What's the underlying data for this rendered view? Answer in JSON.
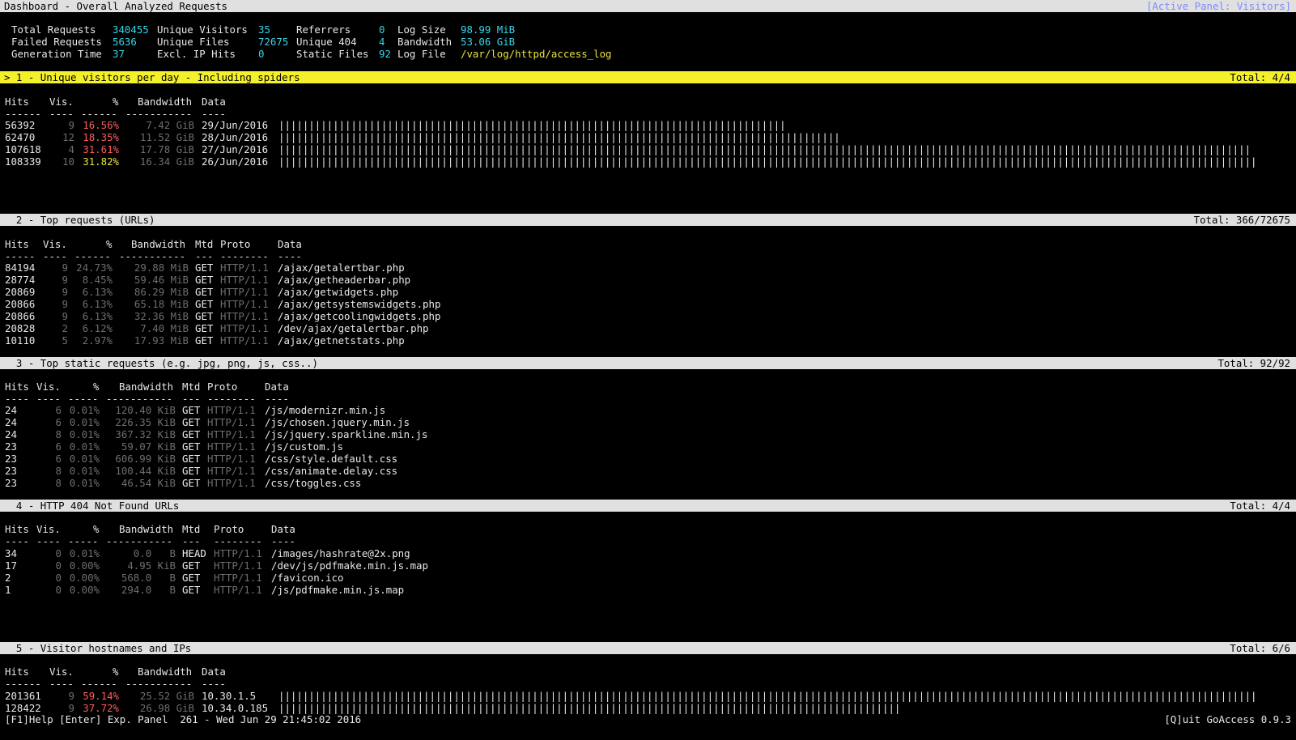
{
  "title": "Dashboard - Overall Analyzed Requests",
  "active_panel": "[Active Panel: Visitors]",
  "overall": {
    "total_requests_label": "Total Requests",
    "total_requests": "340455",
    "failed_requests_label": "Failed Requests",
    "failed_requests": "5636",
    "generation_time_label": "Generation Time",
    "generation_time": "37",
    "unique_visitors_label": "Unique Visitors",
    "unique_visitors": "35",
    "unique_files_label": "Unique Files",
    "unique_files": "72675",
    "excl_ip_hits_label": "Excl. IP Hits",
    "excl_ip_hits": "0",
    "referrers_label": "Referrers",
    "referrers": "0",
    "unique_404_label": "Unique 404",
    "unique_404": "4",
    "static_files_label": "Static Files",
    "static_files": "92",
    "log_size_label": "Log Size",
    "log_size": "98.99 MiB",
    "bandwidth_label": "Bandwidth",
    "bandwidth": "53.06 GiB",
    "log_file_label": "Log File",
    "log_file": "/var/log/httpd/access_log"
  },
  "panels": {
    "visitors": {
      "title": "> 1 - Unique visitors per day - Including spiders",
      "total": "Total: 4/4",
      "headers": {
        "hits": "Hits",
        "vis": "Vis.",
        "pct": "%",
        "bw": "Bandwidth",
        "data": "Data"
      },
      "dashes": {
        "hits": "------",
        "vis": "----",
        "pct": "------",
        "bw": "-----------",
        "data": "----"
      },
      "rows": [
        {
          "hits": "56392",
          "vis": "9",
          "pct": "16.56%",
          "bw": "7.42 GiB",
          "data": "29/Jun/2016",
          "bar": 0.521
        },
        {
          "hits": "62470",
          "vis": "12",
          "pct": "18.35%",
          "bw": "11.52 GiB",
          "data": "28/Jun/2016",
          "bar": 0.577
        },
        {
          "hits": "107618",
          "vis": "4",
          "pct": "31.61%",
          "bw": "17.78 GiB",
          "data": "27/Jun/2016",
          "bar": 0.994
        },
        {
          "hits": "108339",
          "vis": "10",
          "pct": "31.82%",
          "bw": "16.34 GiB",
          "data": "26/Jun/2016",
          "bar": 1.0
        }
      ]
    },
    "requests": {
      "title": "  2 - Top requests (URLs)",
      "total": "Total: 366/72675",
      "headers": {
        "hits": "Hits",
        "vis": "Vis.",
        "pct": "%",
        "bw": "Bandwidth",
        "mtd": "Mtd",
        "proto": "Proto",
        "data": "Data"
      },
      "dashes": {
        "hits": "-----",
        "vis": "----",
        "pct": "------",
        "bw": "-----------",
        "mtd": "---",
        "proto": "--------",
        "data": "----"
      },
      "rows": [
        {
          "hits": "84194",
          "vis": "9",
          "pct": "24.73%",
          "bw": "29.88 MiB",
          "mtd": "GET",
          "proto": "HTTP/1.1",
          "data": "/ajax/getalertbar.php"
        },
        {
          "hits": "28774",
          "vis": "9",
          "pct": "8.45%",
          "bw": "59.46 MiB",
          "mtd": "GET",
          "proto": "HTTP/1.1",
          "data": "/ajax/getheaderbar.php"
        },
        {
          "hits": "20869",
          "vis": "9",
          "pct": "6.13%",
          "bw": "86.29 MiB",
          "mtd": "GET",
          "proto": "HTTP/1.1",
          "data": "/ajax/getwidgets.php"
        },
        {
          "hits": "20866",
          "vis": "9",
          "pct": "6.13%",
          "bw": "65.18 MiB",
          "mtd": "GET",
          "proto": "HTTP/1.1",
          "data": "/ajax/getsystemswidgets.php"
        },
        {
          "hits": "20866",
          "vis": "9",
          "pct": "6.13%",
          "bw": "32.36 MiB",
          "mtd": "GET",
          "proto": "HTTP/1.1",
          "data": "/ajax/getcoolingwidgets.php"
        },
        {
          "hits": "20828",
          "vis": "2",
          "pct": "6.12%",
          "bw": "7.40 MiB",
          "mtd": "GET",
          "proto": "HTTP/1.1",
          "data": "/dev/ajax/getalertbar.php"
        },
        {
          "hits": "10110",
          "vis": "5",
          "pct": "2.97%",
          "bw": "17.93 MiB",
          "mtd": "GET",
          "proto": "HTTP/1.1",
          "data": "/ajax/getnetstats.php"
        }
      ]
    },
    "static": {
      "title": "  3 - Top static requests (e.g. jpg, png, js, css..)",
      "total": "Total: 92/92",
      "headers": {
        "hits": "Hits",
        "vis": "Vis.",
        "pct": "%",
        "bw": "Bandwidth",
        "mtd": "Mtd",
        "proto": "Proto",
        "data": "Data"
      },
      "dashes": {
        "hits": "----",
        "vis": "----",
        "pct": "-----",
        "bw": "-----------",
        "mtd": "---",
        "proto": "--------",
        "data": "----"
      },
      "rows": [
        {
          "hits": "24",
          "vis": "6",
          "pct": "0.01%",
          "bw": "120.40 KiB",
          "mtd": "GET",
          "proto": "HTTP/1.1",
          "data": "/js/modernizr.min.js"
        },
        {
          "hits": "24",
          "vis": "6",
          "pct": "0.01%",
          "bw": "226.35 KiB",
          "mtd": "GET",
          "proto": "HTTP/1.1",
          "data": "/js/chosen.jquery.min.js"
        },
        {
          "hits": "24",
          "vis": "8",
          "pct": "0.01%",
          "bw": "367.32 KiB",
          "mtd": "GET",
          "proto": "HTTP/1.1",
          "data": "/js/jquery.sparkline.min.js"
        },
        {
          "hits": "23",
          "vis": "6",
          "pct": "0.01%",
          "bw": "59.07 KiB",
          "mtd": "GET",
          "proto": "HTTP/1.1",
          "data": "/js/custom.js"
        },
        {
          "hits": "23",
          "vis": "6",
          "pct": "0.01%",
          "bw": "606.99 KiB",
          "mtd": "GET",
          "proto": "HTTP/1.1",
          "data": "/css/style.default.css"
        },
        {
          "hits": "23",
          "vis": "8",
          "pct": "0.01%",
          "bw": "100.44 KiB",
          "mtd": "GET",
          "proto": "HTTP/1.1",
          "data": "/css/animate.delay.css"
        },
        {
          "hits": "23",
          "vis": "8",
          "pct": "0.01%",
          "bw": "46.54 KiB",
          "mtd": "GET",
          "proto": "HTTP/1.1",
          "data": "/css/toggles.css"
        }
      ]
    },
    "notfound": {
      "title": "  4 - HTTP 404 Not Found URLs",
      "total": "Total: 4/4",
      "headers": {
        "hits": "Hits",
        "vis": "Vis.",
        "pct": "%",
        "bw": "Bandwidth",
        "mtd": "Mtd",
        "proto": "Proto",
        "data": "Data"
      },
      "dashes": {
        "hits": "----",
        "vis": "----",
        "pct": "-----",
        "bw": "-----------",
        "mtd": "---",
        "proto": "--------",
        "data": "----"
      },
      "rows": [
        {
          "hits": "34",
          "vis": "0",
          "pct": "0.01%",
          "bw": "0.0   B",
          "mtd": "HEAD",
          "proto": "HTTP/1.1",
          "data": "/images/hashrate@2x.png"
        },
        {
          "hits": "17",
          "vis": "0",
          "pct": "0.00%",
          "bw": "4.95 KiB",
          "mtd": "GET",
          "proto": "HTTP/1.1",
          "data": "/dev/js/pdfmake.min.js.map"
        },
        {
          "hits": "2",
          "vis": "0",
          "pct": "0.00%",
          "bw": "568.0   B",
          "mtd": "GET",
          "proto": "HTTP/1.1",
          "data": "/favicon.ico"
        },
        {
          "hits": "1",
          "vis": "0",
          "pct": "0.00%",
          "bw": "294.0   B",
          "mtd": "GET",
          "proto": "HTTP/1.1",
          "data": "/js/pdfmake.min.js.map"
        }
      ]
    },
    "hosts": {
      "title": "  5 - Visitor hostnames and IPs",
      "total": "Total: 6/6",
      "headers": {
        "hits": "Hits",
        "vis": "Vis.",
        "pct": "%",
        "bw": "Bandwidth",
        "data": "Data"
      },
      "dashes": {
        "hits": "------",
        "vis": "----",
        "pct": "------",
        "bw": "-----------",
        "data": "----"
      },
      "rows": [
        {
          "hits": "201361",
          "vis": "9",
          "pct": "59.14%",
          "bw": "25.52 GiB",
          "data": "10.30.1.5",
          "bar": 1.0
        },
        {
          "hits": "128422",
          "vis": "9",
          "pct": "37.72%",
          "bw": "26.98 GiB",
          "data": "10.34.0.185",
          "bar": 0.637
        }
      ]
    }
  },
  "footer": {
    "left": "[F1]Help [Enter] Exp. Panel  261 - Wed Jun 29 21:45:02 2016",
    "right": "[Q]uit GoAccess 0.9.3"
  },
  "colors": {
    "cyan": "#37d5e8",
    "yellow": "#eae23c",
    "red": "#ff5a5a",
    "gray": "#6e6e6e",
    "active_bar": "#f4f02a",
    "panel_bar": "#e0e0e0",
    "active_panel_text": "#7b8cff"
  }
}
